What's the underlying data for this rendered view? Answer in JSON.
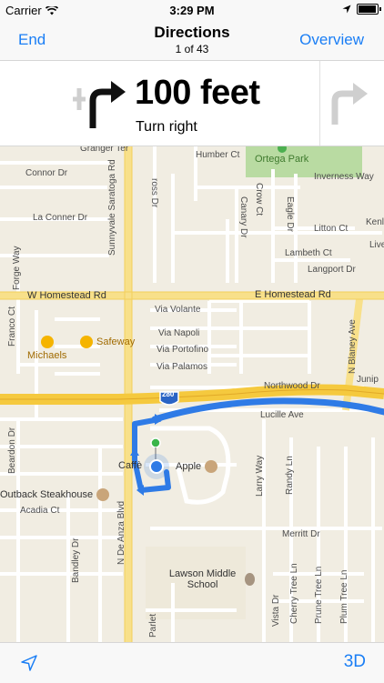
{
  "status_bar": {
    "carrier": "Carrier",
    "time": "3:29 PM"
  },
  "nav": {
    "left_label": "End",
    "title": "Directions",
    "subtitle": "1 of 43",
    "right_label": "Overview"
  },
  "instruction": {
    "distance": "100 feet",
    "maneuver": "Turn right",
    "icon": "turn-right-arrow-icon",
    "next_icon": "next-turn-right-arrow-icon"
  },
  "map": {
    "streets": {
      "w_homestead": "W Homestead Rd",
      "e_homestead": "E Homestead Rd",
      "inverness": "Inverness Way",
      "humber": "Humber Ct",
      "connor": "Connor Dr",
      "la_conner": "La Conner Dr",
      "litton": "Litton Ct",
      "lambeth": "Lambeth Ct",
      "langport": "Langport Dr",
      "via_volante": "Via Volante",
      "via_napoli": "Via Napoli",
      "via_portofino": "Via Portofino",
      "via_palamos": "Via Palamos",
      "northwood": "Northwood Dr",
      "lucille": "Lucille Ave",
      "acadia": "Acadia Ct",
      "merritt": "Merritt Dr",
      "sunnyvale_saratoga": "Sunnyvale Saratoga Rd",
      "n_de_anza": "N De Anza Blvd",
      "n_blaney": "N Blaney Ave",
      "forge": "Forge Way",
      "franco": "Franco Ct",
      "beardon": "Beardon Dr",
      "bandley": "Bandley Dr",
      "crow": "Crow Ct",
      "canary": "Canary Dr",
      "eagle": "Eagle Dr",
      "larry": "Larry Way",
      "randy": "Randy Ln",
      "cherry_tree": "Cherry Tree Ln",
      "prune_tree": "Prune Tree Ln",
      "plum_tree": "Plum Tree Ln",
      "vista": "Vista Dr",
      "parlet": "Parlet",
      "orange_partial": "Granger Ter",
      "cross_partial": "ross Dr",
      "kenl_partial": "Kenl",
      "live_partial": "Live",
      "junip_partial": "Junip",
      "highway_shield": "280"
    },
    "pois": {
      "ortega_park": "Ortega Park",
      "safeway": "Safeway",
      "michaels": "Michaels",
      "outback": "Outback Steakhouse",
      "caffe": "Caffè",
      "apple": "Apple",
      "school": "Lawson Middle School"
    }
  },
  "bottom_bar": {
    "locate_icon": "location-arrow-icon",
    "toggle_3d": "3D"
  },
  "colors": {
    "accent": "#1a7ef5",
    "route": "#2f7be6",
    "freeway": "#f5c93e",
    "park": "#b9dba2"
  }
}
